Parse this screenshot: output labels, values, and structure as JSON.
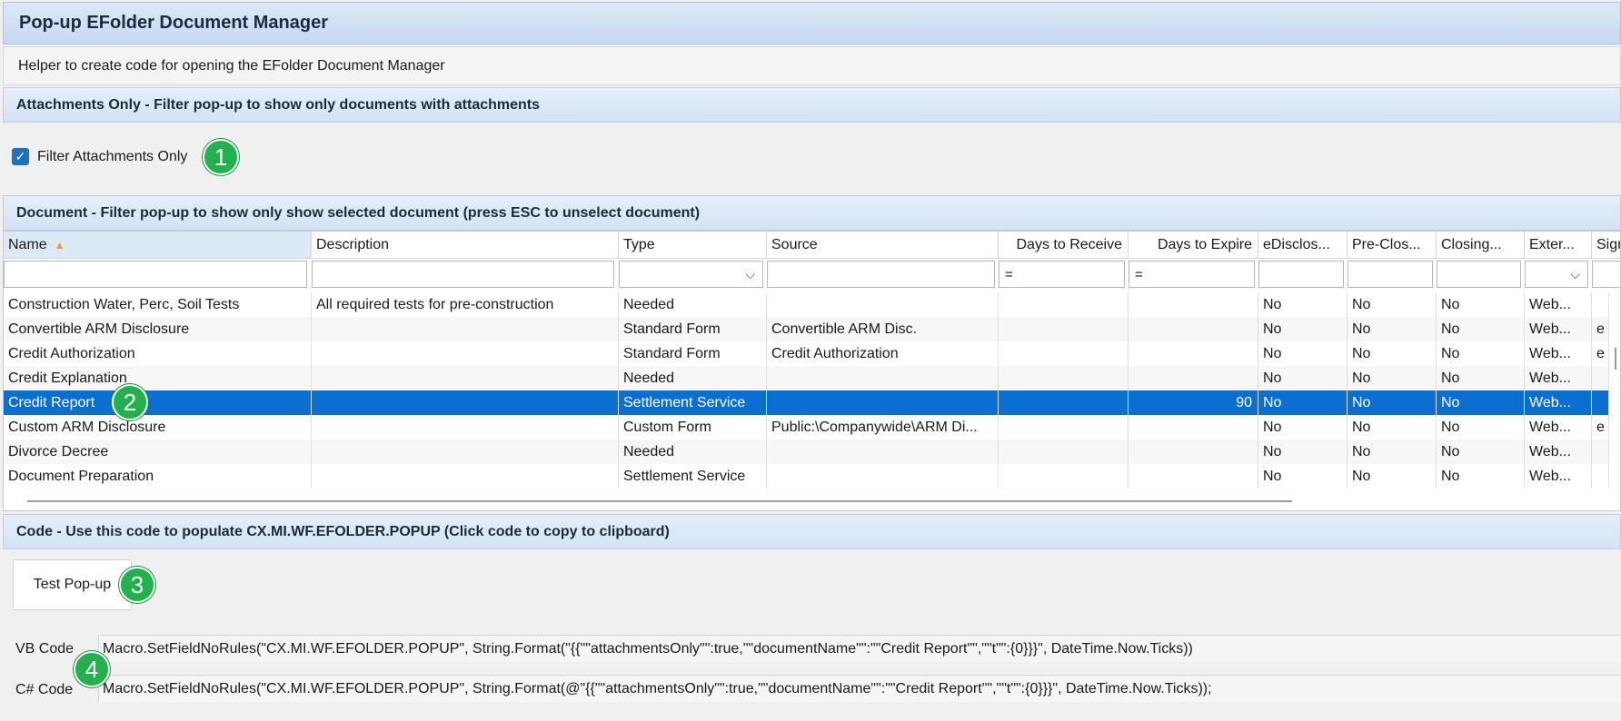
{
  "window": {
    "title": "Pop-up EFolder Document Manager"
  },
  "helper_text": "Helper to create code for opening the EFolder Document Manager",
  "sections": {
    "attachments": "Attachments Only - Filter pop-up to show only documents with attachments",
    "document": "Document - Filter pop-up to show only show selected document (press ESC to unselect document)",
    "code": "Code - Use this code to populate CX.MI.WF.EFOLDER.POPUP (Click code to copy to clipboard)"
  },
  "filter_attachments": {
    "label": "Filter Attachments Only",
    "checked": true,
    "check_glyph": "✓"
  },
  "badges": [
    "1",
    "2",
    "3",
    "4"
  ],
  "grid": {
    "columns": [
      "Name",
      "Description",
      "Type",
      "Source",
      "Days to Receive",
      "Days to Expire",
      "eDisclos...",
      "Pre-Clos...",
      "Closing...",
      "Exter...",
      "Sign"
    ],
    "sort_glyph": "▲",
    "filters": {
      "days_to_receive": "=",
      "days_to_expire": "=",
      "dropdown_glyph": "⌵"
    },
    "rows": [
      {
        "name": "Construction Water, Perc, Soil Tests",
        "description": "All required tests for pre-construction",
        "type": "Needed",
        "source": "",
        "receive": "",
        "expire": "",
        "edisc": "No",
        "preclos": "No",
        "closing": "No",
        "exter": "Web...",
        "sign": ""
      },
      {
        "name": "Convertible ARM Disclosure",
        "description": "",
        "type": "Standard Form",
        "source": "Convertible ARM Disc.",
        "receive": "",
        "expire": "",
        "edisc": "No",
        "preclos": "No",
        "closing": "No",
        "exter": "Web...",
        "sign": "e"
      },
      {
        "name": "Credit Authorization",
        "description": "",
        "type": "Standard Form",
        "source": "Credit Authorization",
        "receive": "",
        "expire": "",
        "edisc": "No",
        "preclos": "No",
        "closing": "No",
        "exter": "Web...",
        "sign": "e"
      },
      {
        "name": "Credit Explanation",
        "description": "",
        "type": "Needed",
        "source": "",
        "receive": "",
        "expire": "",
        "edisc": "No",
        "preclos": "No",
        "closing": "No",
        "exter": "Web...",
        "sign": ""
      },
      {
        "name": "Credit Report",
        "description": "",
        "type": "Settlement Service",
        "source": "",
        "receive": "",
        "expire": "90",
        "edisc": "No",
        "preclos": "No",
        "closing": "No",
        "exter": "Web...",
        "sign": ""
      },
      {
        "name": "Custom ARM Disclosure",
        "description": "",
        "type": "Custom Form",
        "source": "Public:\\Companywide\\ARM Di...",
        "receive": "",
        "expire": "",
        "edisc": "No",
        "preclos": "No",
        "closing": "No",
        "exter": "Web...",
        "sign": "e"
      },
      {
        "name": "Divorce Decree",
        "description": "",
        "type": "Needed",
        "source": "",
        "receive": "",
        "expire": "",
        "edisc": "No",
        "preclos": "No",
        "closing": "No",
        "exter": "Web...",
        "sign": ""
      },
      {
        "name": "Document Preparation",
        "description": "",
        "type": "Settlement Service",
        "source": "",
        "receive": "",
        "expire": "",
        "edisc": "No",
        "preclos": "No",
        "closing": "No",
        "exter": "Web...",
        "sign": ""
      }
    ]
  },
  "test_button": "Test Pop-up",
  "code": {
    "vb_label": "VB Code",
    "vb": "Macro.SetFieldNoRules(\"CX.MI.WF.EFOLDER.POPUP\", String.Format(\"{{\"\"attachmentsOnly\"\":true,\"\"documentName\"\":\"\"Credit Report\"\",\"\"t\"\":{0}}}\", DateTime.Now.Ticks))",
    "cs_label": "C# Code",
    "cs": "Macro.SetFieldNoRules(\"CX.MI.WF.EFOLDER.POPUP\", String.Format(@\"{{\"\"attachmentsOnly\"\":true,\"\"documentName\"\":\"\"Credit Report\"\",\"\"t\"\":{0}}}\", DateTime.Now.Ticks));"
  }
}
